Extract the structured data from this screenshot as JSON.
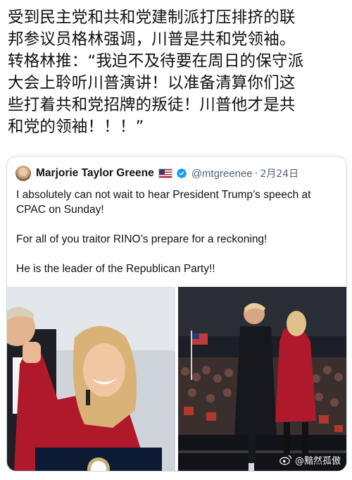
{
  "post": {
    "text": "受到民主党和共和党建制派打压排挤的联\n邦参议员格林强调，川普是共和党领袖。\n转格林推：“我迫不及待要在周日的保守派\n大会上聆听川普演讲！以准备清算你们这\n些打着共和党招牌的叛徒！川普他才是共\n和党的领袖！！！”"
  },
  "quote": {
    "author_name": "Marjorie Taylor Greene",
    "handle": "@mtgreenee",
    "separator": "·",
    "date": "2月24日",
    "paragraphs": [
      "I absolutely can not wait to hear President Trump’s speech at CPAC on Sunday!",
      "For all of you traitor RINO’s prepare for a reckoning!",
      "He is the leader of the Republican Party!!"
    ],
    "icons": {
      "flag": "us-flag-icon",
      "verified": "verified-badge-icon"
    }
  },
  "watermark": {
    "text": "@黯然孤傲"
  },
  "colors": {
    "text": "#111111",
    "handle_gray": "#536471",
    "verified_blue": "#1d9bf0",
    "card_border": "#cfd9de",
    "dress_red": "#b0192b"
  }
}
